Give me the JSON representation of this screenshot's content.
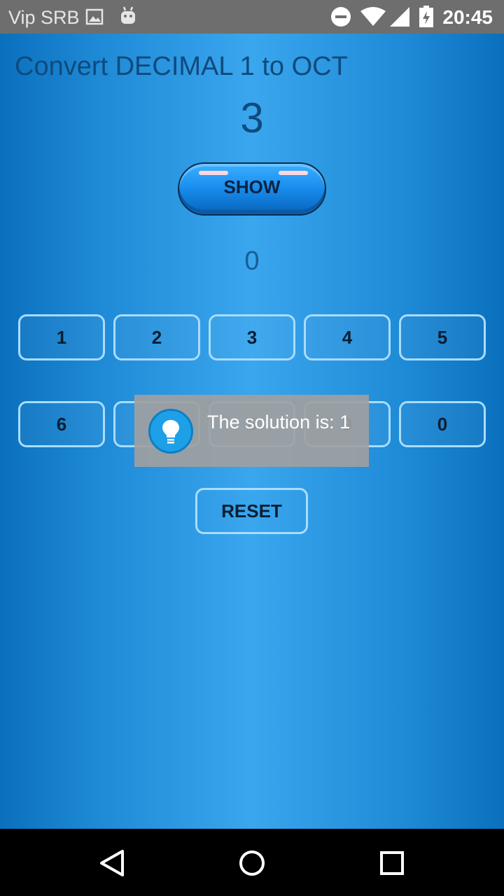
{
  "status_bar": {
    "carrier": "Vip SRB",
    "time": "20:45",
    "icons": [
      "image-icon",
      "android-icon",
      "do-not-disturb-icon",
      "wifi-icon",
      "signal-icon",
      "battery-charging-icon"
    ]
  },
  "app": {
    "question": "Convert DECIMAL 1 to OCT",
    "target_number": "3",
    "show_label": "SHOW",
    "answer": "0",
    "digits_row1": [
      "1",
      "2",
      "3",
      "4",
      "5"
    ],
    "digits_row2": [
      "6",
      "7",
      "8",
      "9",
      "0"
    ],
    "reset_label": "RESET"
  },
  "toast": {
    "icon": "lightbulb-icon",
    "text": "The solution is: 1"
  },
  "nav_bar": {
    "icons": [
      "back-icon",
      "home-icon",
      "recents-icon"
    ]
  },
  "colors": {
    "background_edge": "#0a70bd",
    "background_center": "#3aa6ee",
    "text_dark_blue": "#0f4a7c",
    "button_border": "#a9dcff",
    "status_bar": "#6e6e6e"
  }
}
